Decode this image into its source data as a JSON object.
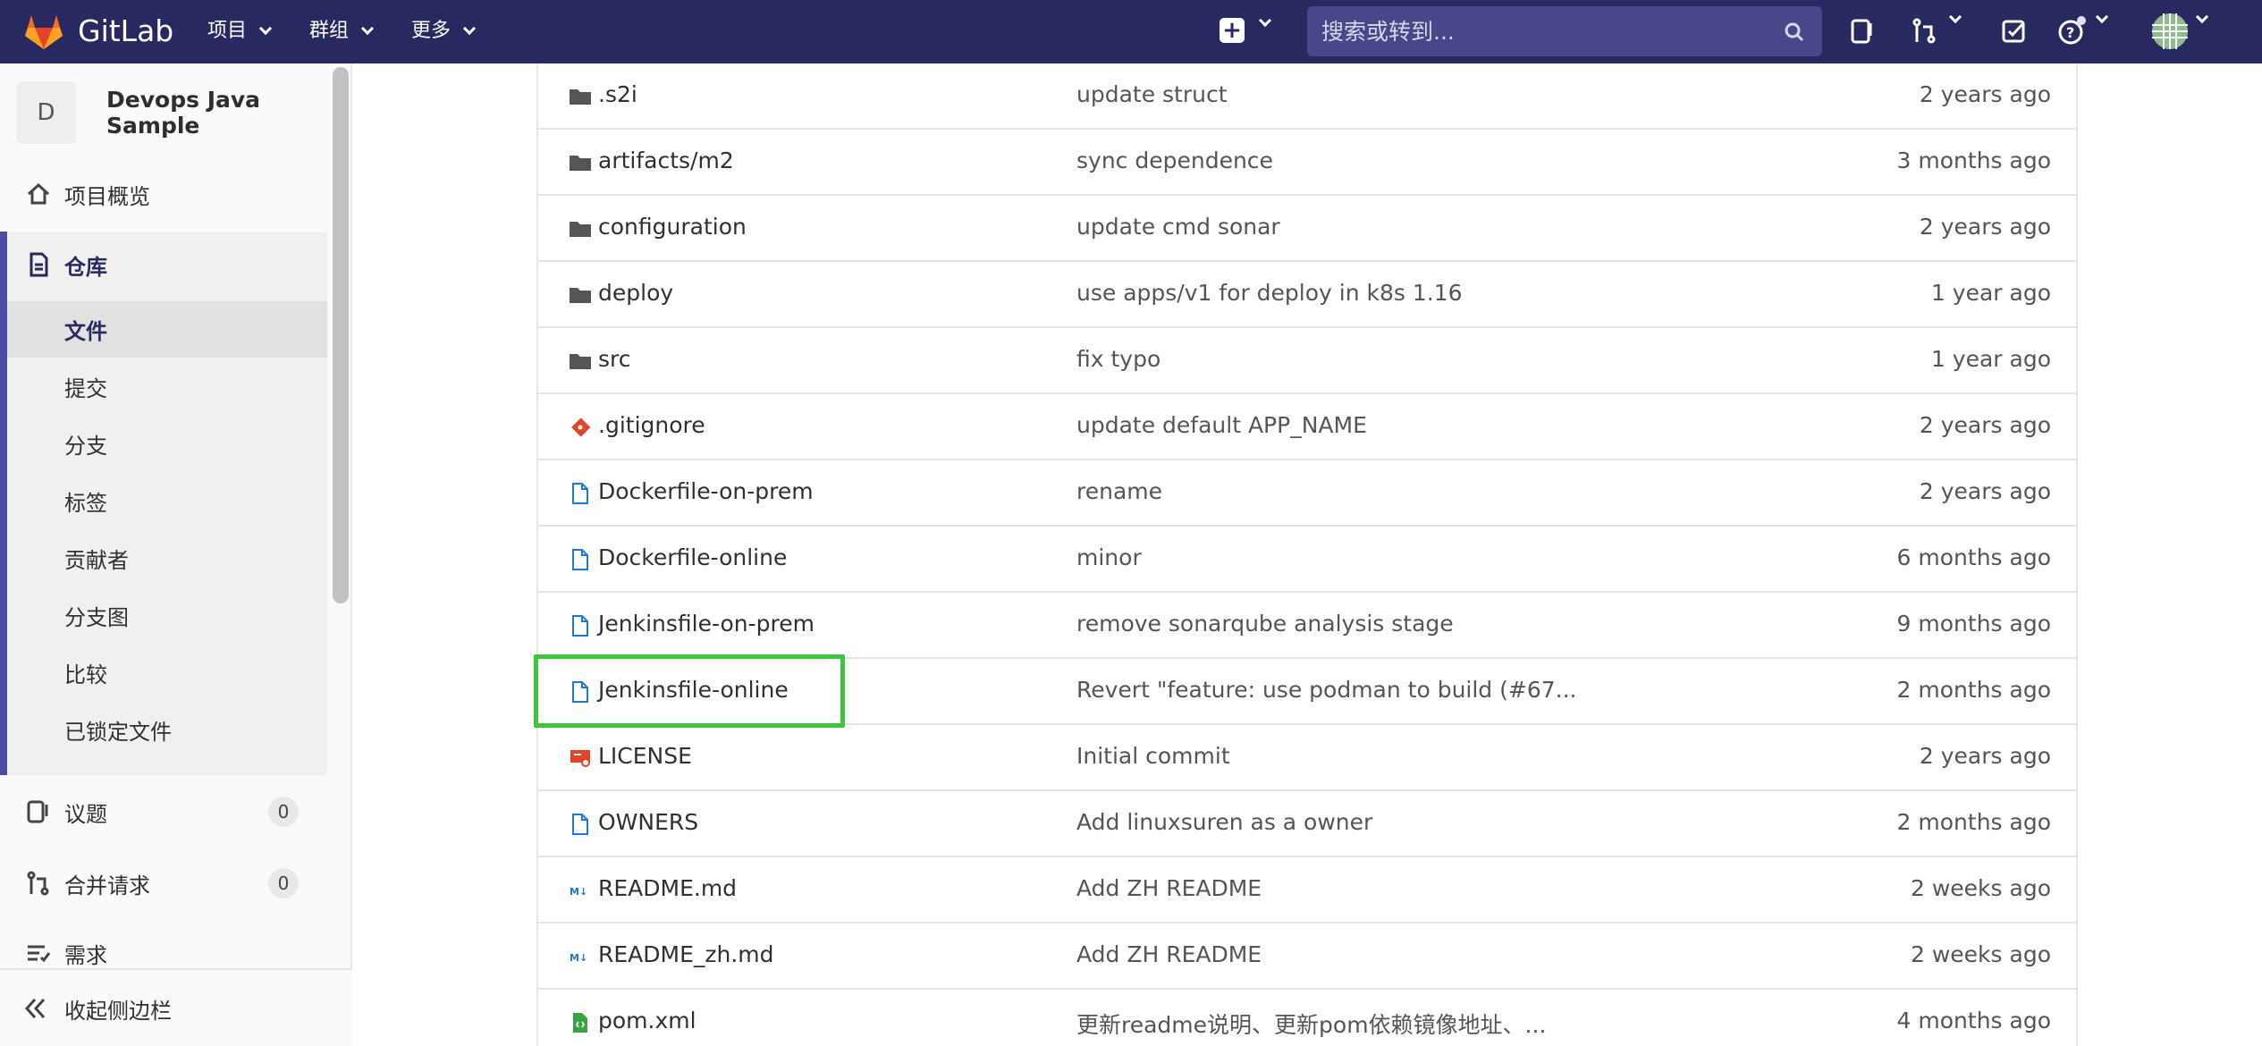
{
  "navbar": {
    "brand": "GitLab",
    "menus": [
      "项目",
      "群组",
      "更多"
    ],
    "search_placeholder": "搜索或转到..."
  },
  "sidebar": {
    "project_avatar": "D",
    "project_name": "Devops Java Sample",
    "overview": "项目概览",
    "repository": "仓库",
    "repo_items": [
      "文件",
      "提交",
      "分支",
      "标签",
      "贡献者",
      "分支图",
      "比较",
      "已锁定文件"
    ],
    "issues": {
      "label": "议题",
      "count": "0"
    },
    "merge_requests": {
      "label": "合并请求",
      "count": "0"
    },
    "requirements": "需求",
    "collapse": "收起侧边栏"
  },
  "files": [
    {
      "icon": "folder-icon",
      "name": ".s2i",
      "message": "update struct",
      "time": "2 years ago"
    },
    {
      "icon": "folder-icon",
      "name": "artifacts/m2",
      "message": "sync dependence",
      "time": "3 months ago"
    },
    {
      "icon": "folder-icon",
      "name": "configuration",
      "message": "update cmd sonar",
      "time": "2 years ago"
    },
    {
      "icon": "folder-icon",
      "name": "deploy",
      "message": "use apps/v1 for deploy in k8s 1.16",
      "time": "1 year ago"
    },
    {
      "icon": "folder-icon",
      "name": "src",
      "message": "fix typo",
      "time": "1 year ago"
    },
    {
      "icon": "git-icon",
      "name": ".gitignore",
      "message": "update default APP_NAME",
      "time": "2 years ago"
    },
    {
      "icon": "file-icon",
      "name": "Dockerfile-on-prem",
      "message": "rename",
      "time": "2 years ago"
    },
    {
      "icon": "file-icon",
      "name": "Dockerfile-online",
      "message": "minor",
      "time": "6 months ago"
    },
    {
      "icon": "file-icon",
      "name": "Jenkinsfile-on-prem",
      "message": "remove sonarqube analysis stage",
      "time": "9 months ago"
    },
    {
      "icon": "file-icon",
      "name": "Jenkinsfile-online",
      "message": "Revert \"feature: use podman to build (#67...",
      "time": "2 months ago"
    },
    {
      "icon": "license-icon",
      "name": "LICENSE",
      "message": "Initial commit",
      "time": "2 years ago"
    },
    {
      "icon": "file-icon",
      "name": "OWNERS",
      "message": "Add linuxsuren as a owner",
      "time": "2 months ago"
    },
    {
      "icon": "markdown-icon",
      "name": "README.md",
      "message": "Add ZH README",
      "time": "2 weeks ago"
    },
    {
      "icon": "markdown-icon",
      "name": "README_zh.md",
      "message": "Add ZH README",
      "time": "2 weeks ago"
    },
    {
      "icon": "xml-icon",
      "name": "pom.xml",
      "message": "更新readme说明、更新pom依赖镜像地址、...",
      "time": "4 months ago"
    }
  ],
  "colors": {
    "navbar": "#292961",
    "active_border": "#4b4ba3",
    "highlight": "#3fc53a"
  }
}
